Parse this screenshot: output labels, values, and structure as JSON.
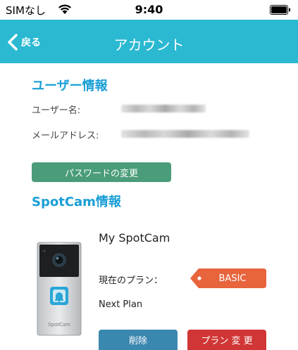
{
  "status_bar": {
    "carrier": "SIMなし",
    "time": "9:40"
  },
  "nav": {
    "back_label": "戻る",
    "title": "アカウント",
    "bar_color": "#2bb9d2"
  },
  "user_info": {
    "section_title": "ユーザー情報",
    "username_label": "ユーザー名:",
    "email_label": "メールアドレス:",
    "change_password_button": "パスワードの変更"
  },
  "spotcam_info": {
    "section_title": "SpotCam情報",
    "camera": {
      "name": "My SpotCam",
      "brand_text": "SpotCam",
      "current_plan_label": "現在のプラン：",
      "current_plan": "BASIC",
      "next_plan_label": "Next Plan",
      "delete_button": "削除",
      "change_plan_button": "プラン 変 更"
    }
  },
  "colors": {
    "section_title": "#1a9fd6",
    "badge": "#e8643c",
    "button_green": "#4a9c7a",
    "button_blue": "#3a87b0",
    "button_red": "#d13636"
  }
}
